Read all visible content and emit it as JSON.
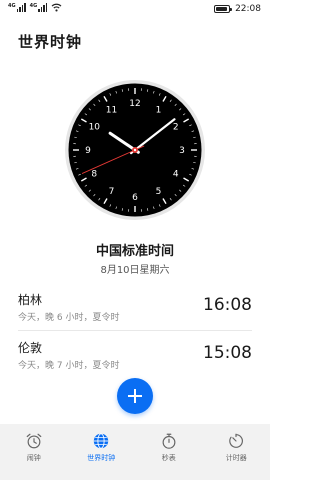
{
  "status_bar": {
    "network_1": "4G",
    "network_2": "4G",
    "time": "22:08",
    "battery_level": 0.9
  },
  "page_title": "世界时钟",
  "analog_clock": {
    "numerals": [
      "12",
      "1",
      "2",
      "3",
      "4",
      "5",
      "6",
      "7",
      "8",
      "9",
      "10",
      "11"
    ],
    "hour": 22,
    "minute": 8,
    "second": 41,
    "face_color": "#000000",
    "hand_color": "#ffffff",
    "second_hand_color": "#e53935"
  },
  "home_zone": {
    "name": "中国标准时间",
    "date": "8月10日星期六"
  },
  "cities": [
    {
      "name": "柏林",
      "info": "今天，晚 6 小时，夏令时",
      "time": "16:08"
    },
    {
      "name": "伦敦",
      "info": "今天，晚 7 小时，夏令时",
      "time": "15:08"
    }
  ],
  "tabs": [
    {
      "label": "闹钟",
      "icon": "alarm-clock-icon",
      "active": false
    },
    {
      "label": "世界时钟",
      "icon": "globe-icon",
      "active": true
    },
    {
      "label": "秒表",
      "icon": "stopwatch-icon",
      "active": false
    },
    {
      "label": "计时器",
      "icon": "timer-icon",
      "active": false
    }
  ],
  "colors": {
    "accent": "#0a6ef3",
    "tabbar_background": "#f2f2f2",
    "secondary_text": "#8a8a8a"
  }
}
